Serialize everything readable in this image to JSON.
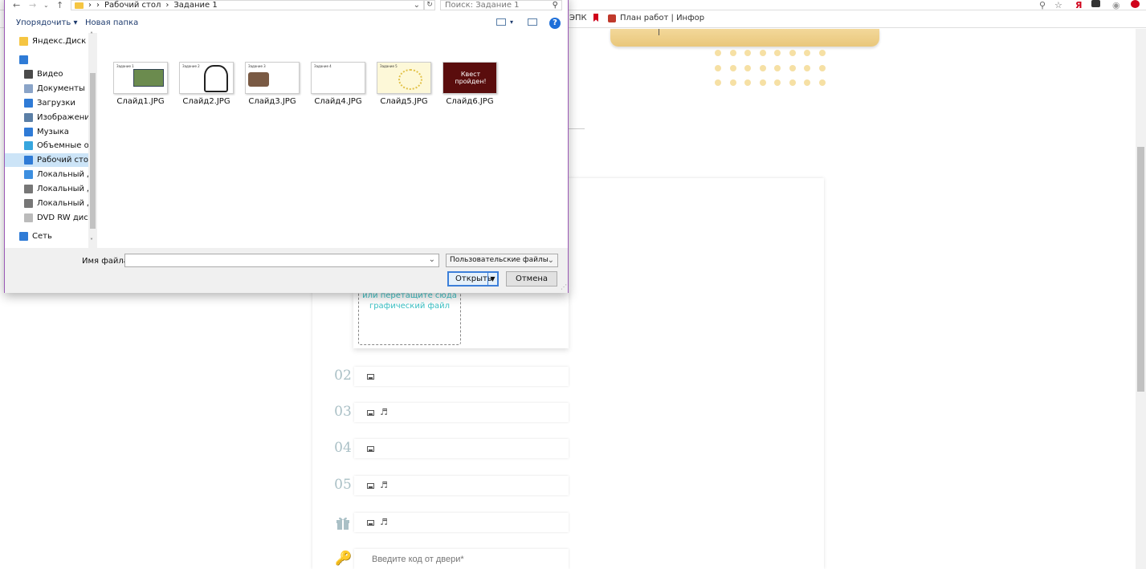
{
  "browser": {
    "bookmarks": [
      {
        "label": "ЭПК",
        "icon": "text-icon"
      },
      {
        "label": "",
        "icon": "bookmark-flag-icon"
      },
      {
        "label": "План работ | Инфор",
        "icon": "trophy-icon"
      }
    ],
    "toolbar_icons": [
      "zoom-icon",
      "star-icon",
      "yandex-icon",
      "extension-icon",
      "eye-icon",
      "adblock-icon"
    ]
  },
  "page": {
    "drop_text": "или перетащите сюда графический файл",
    "steps": [
      {
        "num": "02",
        "icons": [
          "image-icon"
        ]
      },
      {
        "num": "03",
        "icons": [
          "image-icon",
          "music-icon"
        ]
      },
      {
        "num": "04",
        "icons": [
          "image-icon"
        ]
      },
      {
        "num": "05",
        "icons": [
          "image-icon",
          "music-icon"
        ]
      },
      {
        "num": "",
        "icons": [
          "image-icon",
          "music-icon"
        ],
        "marker": "gift-icon"
      }
    ],
    "code_placeholder": "Введите код от двери*"
  },
  "dialog": {
    "breadcrumb": [
      "Рабочий стол",
      "Задание 1"
    ],
    "search_placeholder": "Поиск: Задание 1",
    "toolbar": {
      "organize": "Упорядочить ▾",
      "new_folder": "Новая папка"
    },
    "nav_items": [
      {
        "label": "Яндекс.Диск",
        "icon": "yandex-disk-icon",
        "color": "#f5c542",
        "top": true
      },
      {
        "label": "",
        "icon": "computer-icon",
        "color": "#2f7bd6",
        "top": true
      },
      {
        "label": "Видео",
        "icon": "video-icon",
        "color": "#4a4a4a"
      },
      {
        "label": "Документы",
        "icon": "documents-icon",
        "color": "#8aa4c8"
      },
      {
        "label": "Загрузки",
        "icon": "downloads-icon",
        "color": "#2f7bd6"
      },
      {
        "label": "Изображения",
        "icon": "pictures-icon",
        "color": "#5b7fa6"
      },
      {
        "label": "Музыка",
        "icon": "music-icon",
        "color": "#2f7bd6"
      },
      {
        "label": "Объемные объ",
        "icon": "3d-objects-icon",
        "color": "#37a6de"
      },
      {
        "label": "Рабочий стол",
        "icon": "desktop-icon",
        "color": "#2f7bd6",
        "selected": true
      },
      {
        "label": "Локальный дис",
        "icon": "windows-drive-icon",
        "color": "#3d8fe0"
      },
      {
        "label": "Локальный дис",
        "icon": "drive-icon",
        "color": "#777"
      },
      {
        "label": "Локальный дис",
        "icon": "drive-icon",
        "color": "#777"
      },
      {
        "label": "DVD RW дисков",
        "icon": "dvd-icon",
        "color": "#bbb"
      },
      {
        "label": "Сеть",
        "icon": "network-icon",
        "color": "#2f7bd6",
        "top": true
      }
    ],
    "files": [
      {
        "name": "Слайд1.JPG",
        "thumb_title": "Задание 1"
      },
      {
        "name": "Слайд2.JPG",
        "thumb_title": "Задание 2"
      },
      {
        "name": "Слайд3.JPG",
        "thumb_title": "Задание 3"
      },
      {
        "name": "Слайд4.JPG",
        "thumb_title": "Задание 4"
      },
      {
        "name": "Слайд5.JPG",
        "thumb_title": "Задание 5"
      },
      {
        "name": "Слайд6.JPG",
        "thumb_title": "Квест пройден!"
      }
    ],
    "filename_label": "Имя файла:",
    "filename_value": "",
    "filter": "Пользовательские файлы",
    "open_label": "Открыть",
    "cancel_label": "Отмена"
  }
}
